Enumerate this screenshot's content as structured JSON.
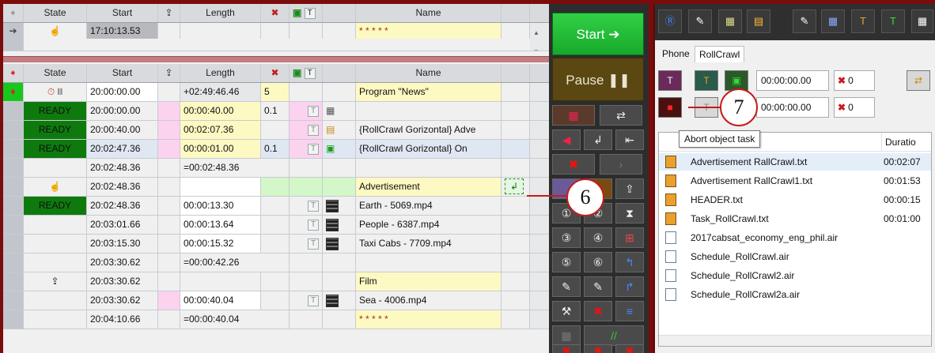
{
  "top_grid": {
    "headers": {
      "state": "State",
      "start": "Start",
      "length": "Length",
      "name": "Name"
    },
    "row": {
      "start": "17:10:13.53",
      "name": "* * * * *"
    }
  },
  "main_grid": {
    "headers": {
      "state": "State",
      "start": "Start",
      "length": "Length",
      "name": "Name"
    },
    "rows": [
      {
        "state": "",
        "start": "20:00:00.00",
        "length": "+02:49:46.46",
        "n": "5",
        "t1": "",
        "name": "Program \"News\""
      },
      {
        "state": "READY",
        "start": "20:00:00.00",
        "length": "00:00:40.00",
        "n": "0.1",
        "t1": "",
        "name": ""
      },
      {
        "state": "READY",
        "start": "20:00:40.00",
        "length": "00:02:07.36",
        "n": "",
        "t1": "",
        "name": "{RollCrawl Gorizontal} Adve"
      },
      {
        "state": "READY",
        "start": "20:02:47.36",
        "length": "00:00:01.00",
        "n": "0.1",
        "t1": "",
        "name": "{RollCrawl Gorizontal} On"
      },
      {
        "state": "",
        "start": "20:02:48.36",
        "length": "=00:02:48.36",
        "n": "",
        "t1": "",
        "name": ""
      },
      {
        "state": "",
        "start": "20:02:48.36",
        "length": "",
        "n": "",
        "t1": "",
        "name": "Advertisement"
      },
      {
        "state": "READY",
        "start": "20:02:48.36",
        "length": "00:00:13.30",
        "n": "",
        "t1": "",
        "name": "Earth - 5069.mp4"
      },
      {
        "state": "",
        "start": "20:03:01.66",
        "length": "00:00:13.64",
        "n": "",
        "t1": "",
        "name": "People - 6387.mp4"
      },
      {
        "state": "",
        "start": "20:03:15.30",
        "length": "00:00:15.32",
        "n": "",
        "t1": "",
        "name": "Taxi Cabs - 7709.mp4"
      },
      {
        "state": "",
        "start": "20:03:30.62",
        "length": "=00:00:42.26",
        "n": "",
        "t1": "",
        "name": ""
      },
      {
        "state": "",
        "start": "20:03:30.62",
        "length": "",
        "n": "",
        "t1": "",
        "name": "Film"
      },
      {
        "state": "",
        "start": "20:03:30.62",
        "length": "00:00:40.04",
        "n": "",
        "t1": "",
        "name": "Sea - 4006.mp4"
      },
      {
        "state": "",
        "start": "20:04:10.66",
        "length": "=00:00:40.04",
        "n": "",
        "t1": "",
        "name": "* * * * *"
      }
    ]
  },
  "controls": {
    "start_label": "Start",
    "pause_label": "Pause"
  },
  "right_panel": {
    "tabs": [
      "Phone",
      "RollCrawl"
    ],
    "time1": "00:00:00.00",
    "count1": "0",
    "time2": "00:00:00.00",
    "count2": "0",
    "tooltip": "Abort object task",
    "list_header_duration": "Duratio",
    "files": [
      {
        "name": "Advertisement RallCrawl.txt",
        "duration": "00:02:07",
        "type": "txt"
      },
      {
        "name": "Advertisement RallCrawl1.txt",
        "duration": "00:01:53",
        "type": "txt"
      },
      {
        "name": "HEADER.txt",
        "duration": "00:00:15",
        "type": "txt"
      },
      {
        "name": "Task_RollCrawl.txt",
        "duration": "00:01:00",
        "type": "txt"
      },
      {
        "name": "2017cabsat_economy_eng_phil.air",
        "duration": "",
        "type": "air"
      },
      {
        "name": "Schedule_RollCrawl.air",
        "duration": "",
        "type": "air"
      },
      {
        "name": "Schedule_RollCrawl2.air",
        "duration": "",
        "type": "air"
      },
      {
        "name": "Schedule_RollCrawl2a.air",
        "duration": "",
        "type": "air"
      }
    ]
  },
  "callouts": {
    "six": "6",
    "seven": "7"
  },
  "colors": {
    "accent_red": "#c41c1c",
    "start_green": "#1fbd32",
    "ready_green": "#0e7a0e"
  }
}
